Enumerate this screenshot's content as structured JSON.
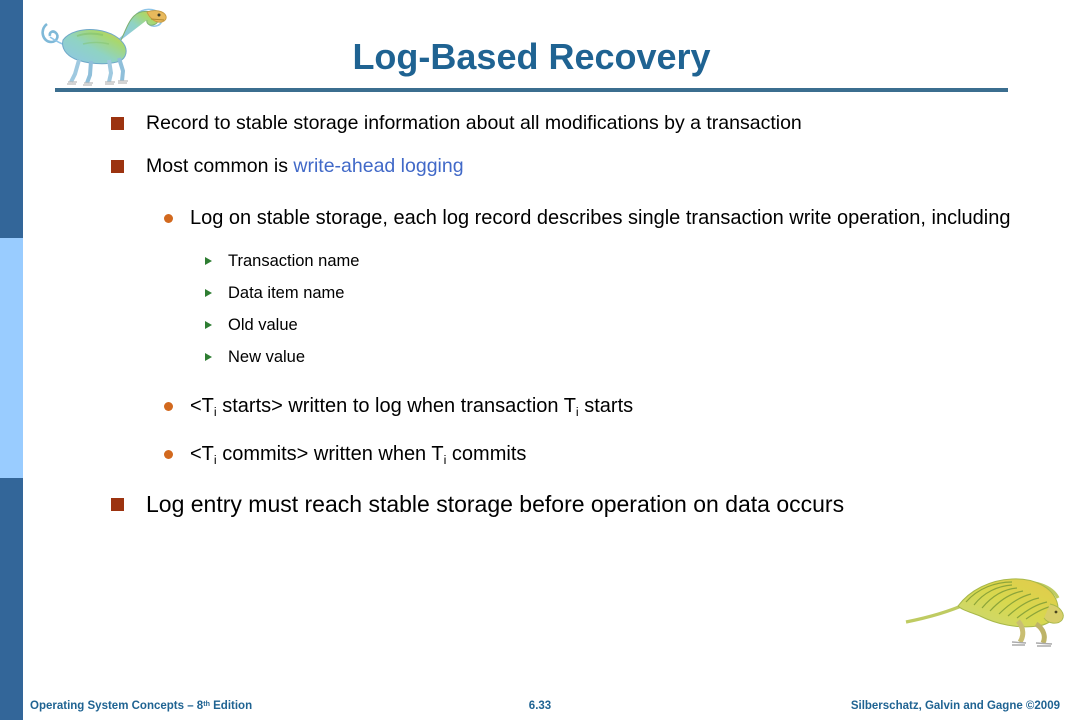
{
  "slide": {
    "title": "Log-Based Recovery",
    "accent_color": "#1F6392",
    "bullet_color": "#9C3310",
    "sub_bullet_color": "#D2691E",
    "sub_sub_bullet_color": "#2E7D32",
    "link_color": "#4169C8",
    "sidebar": {
      "top_color": "#336699",
      "middle_color": "#99CCFF",
      "bottom_color": "#336699"
    },
    "images": {
      "top_left": "dinosaur-illustration",
      "bottom_right": "dinosaur-illustration"
    }
  },
  "body": {
    "b1": "Record to stable storage information about all modifications by a transaction",
    "b2_prefix": "Most common is ",
    "b2_accent": "write-ahead logging",
    "b3": "Log on stable storage, each log record describes single transaction write operation, including",
    "b3_items": [
      "Transaction name",
      "Data item name",
      "Old value",
      "New value"
    ],
    "b4_part1": "<T",
    "b4_sub1": "i",
    "b4_part2": " starts> written to log when transaction T",
    "b4_sub2": "i",
    "b4_part3": " starts",
    "b5_part1": "<T",
    "b5_sub1": "i",
    "b5_part2": " commits> written when T",
    "b5_sub2": "i",
    "b5_part3": " commits",
    "b6": "Log entry must reach stable storage before operation on data occurs"
  },
  "footer": {
    "left_main": "Operating System Concepts – 8",
    "left_sup": "th",
    "left_tail": " Edition",
    "page_number": "6.33",
    "right": "Silberschatz, Galvin and Gagne ©2009"
  }
}
